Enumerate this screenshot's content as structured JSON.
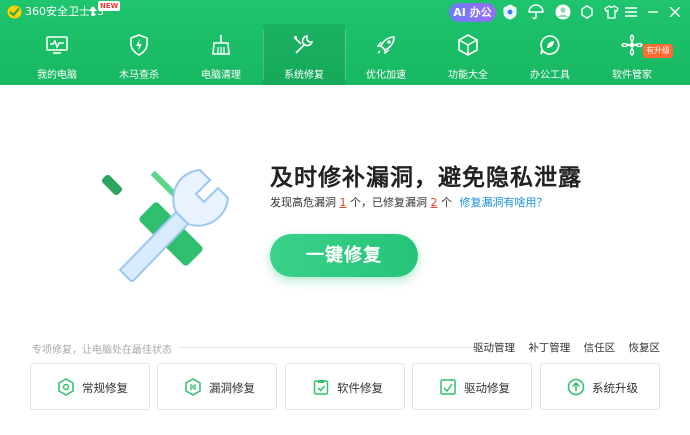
{
  "window": {
    "app_title": "360安全卫士13",
    "new_badge": "NEW",
    "ai_button": "AI 办公"
  },
  "nav": {
    "items": [
      {
        "label": "我的电脑",
        "icon": "monitor-icon"
      },
      {
        "label": "木马查杀",
        "icon": "shield-bolt-icon"
      },
      {
        "label": "电脑清理",
        "icon": "broom-icon"
      },
      {
        "label": "系统修复",
        "icon": "wrench-icon",
        "active": true
      },
      {
        "label": "优化加速",
        "icon": "rocket-icon"
      },
      {
        "label": "功能大全",
        "icon": "cube-icon"
      },
      {
        "label": "办公工具",
        "icon": "leaf-bubble-icon"
      },
      {
        "label": "软件管家",
        "icon": "flower-icon"
      }
    ],
    "upgrade_badge": "有升级"
  },
  "hero": {
    "headline": "及时修补漏洞，避免隐私泄露",
    "found_prefix": "发现高危漏洞",
    "found_count": "1",
    "found_unit": "个，已修复漏洞",
    "fixed_count": "2",
    "fixed_unit": "个",
    "help_link": "修复漏洞有啥用？",
    "main_button": "一键修复"
  },
  "section": {
    "hint": "专项修复，让电脑处在最佳状态",
    "links": [
      "驱动管理",
      "补丁管理",
      "信任区",
      "恢复区"
    ]
  },
  "cards": [
    {
      "label": "常规修复",
      "icon": "hexagon-check-icon"
    },
    {
      "label": "漏洞修复",
      "icon": "bug-patch-icon"
    },
    {
      "label": "软件修复",
      "icon": "clipboard-check-icon"
    },
    {
      "label": "驱动修复",
      "icon": "chart-check-icon"
    },
    {
      "label": "系统升级",
      "icon": "arrow-up-circle-icon"
    }
  ],
  "colors": {
    "brand_green": "#1fc46e",
    "accent_red": "#e8412c",
    "link_blue": "#1a8fe3"
  }
}
